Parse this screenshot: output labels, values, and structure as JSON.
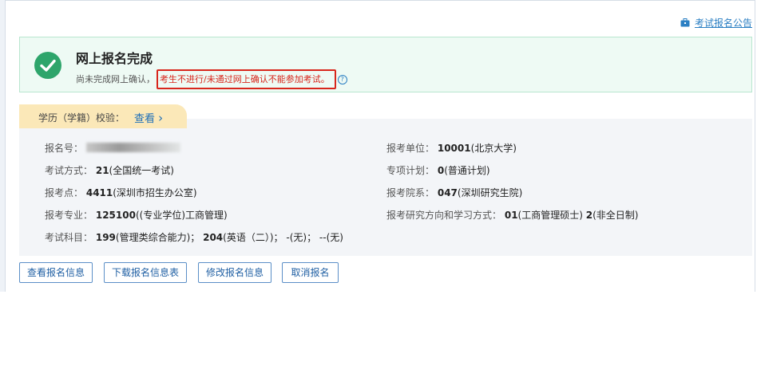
{
  "header": {
    "notice_link": "考试报名公告",
    "notice_icon": "briefcase-icon"
  },
  "success": {
    "icon": "check-circle-icon",
    "title": "网上报名完成",
    "sub_prefix": "尚未完成网上确认，",
    "warning": "考生不进行/未通过网上确认不能参加考试。",
    "help_icon": "question-circle-icon",
    "help_glyph": "?"
  },
  "education_tab": {
    "label": "学历（学籍）校验：",
    "link": "查看",
    "link_arrow": "›"
  },
  "info": {
    "left": [
      {
        "label": "报名号：",
        "value": ""
      },
      {
        "label": "考试方式：",
        "value": "21",
        "value_rest": "(全国统一考试)"
      },
      {
        "label": "报考点：",
        "value": "4411",
        "value_rest": "(深圳市招生办公室)"
      },
      {
        "label": "报考专业：",
        "value": "125100",
        "value_rest": "((专业学位)工商管理)"
      },
      {
        "label": "考试科目：",
        "value": "199",
        "value_rest": "(管理类综合能力)；",
        "value2": "204",
        "value2_rest": "(英语（二）)；",
        "value3": "-(无)；",
        "value4": "--(无)"
      }
    ],
    "right": [
      {
        "label": "报考单位：",
        "value": "10001",
        "value_rest": "(北京大学)"
      },
      {
        "label": "专项计划：",
        "value": "0",
        "value_rest": "(普通计划)"
      },
      {
        "label": "报考院系：",
        "value": "047",
        "value_rest": "(深圳研究生院)"
      },
      {
        "label": "报考研究方向和学习方式：",
        "value": "01",
        "value_rest": "(工商管理硕士)",
        "value2": "2",
        "value2_rest": "(非全日制)"
      }
    ]
  },
  "buttons": {
    "view": "查看报名信息",
    "download": "下载报名信息表",
    "edit": "修改报名信息",
    "cancel": "取消报名"
  },
  "colors": {
    "success_green": "#2ea56b",
    "warning_red": "#d8261c",
    "link_blue": "#1f6fb8",
    "tab_yellow": "#fbe8b8"
  }
}
